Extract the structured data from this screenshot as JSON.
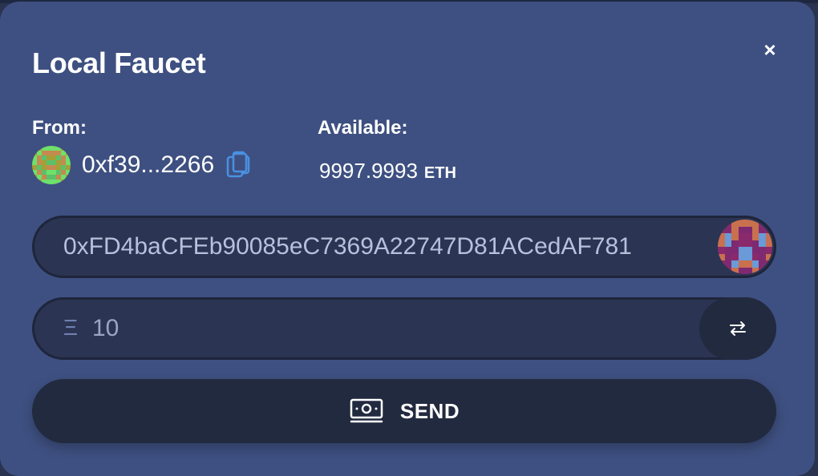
{
  "modal": {
    "title": "Local Faucet",
    "close_glyph": "×"
  },
  "from": {
    "label": "From:",
    "address": "0xf39...2266",
    "avatar_icon": "blockie-avatar-icon",
    "copy_icon": "copy-icon"
  },
  "available": {
    "label": "Available:",
    "amount": "9997.9993",
    "unit": "ETH"
  },
  "recipient": {
    "value": "0xFD4baCFEb90085eC7369A22747D81ACedAF781",
    "avatar_icon": "blockie-avatar-icon"
  },
  "amount": {
    "prefix": "Ξ",
    "value": "10",
    "swap_icon": "swap-arrows-icon"
  },
  "send": {
    "label": "SEND",
    "icon": "cash-icon"
  },
  "colors": {
    "modal_bg": "#3e5081",
    "input_bg": "#2b3452",
    "button_bg": "#222a3f",
    "copy_icon": "#4a90e2"
  }
}
